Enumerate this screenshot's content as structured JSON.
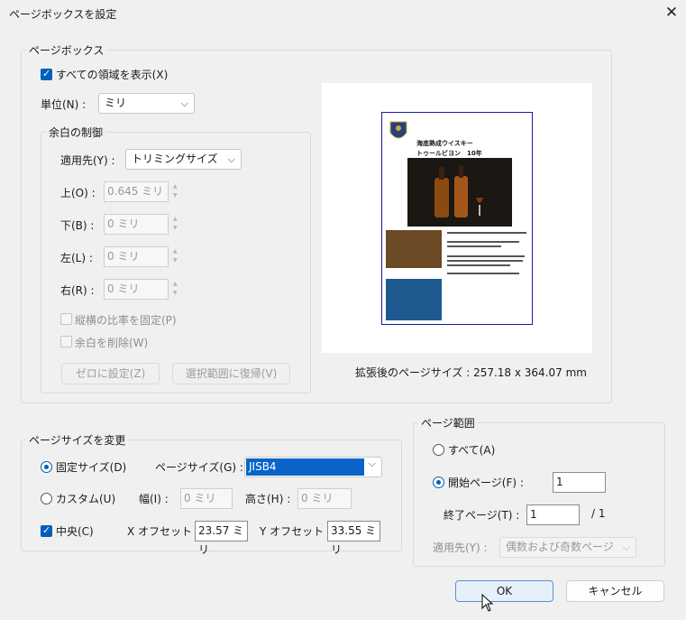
{
  "window": {
    "title": "ページボックスを設定",
    "close_glyph": "✕"
  },
  "page_box": {
    "legend": "ページボックス",
    "show_all": {
      "label": "すべての領域を表示(X)",
      "checked": true
    },
    "unit_label": "単位(N) :",
    "unit_value": "ミリ",
    "margin_group": {
      "legend": "余白の制御",
      "apply_label": "適用先(Y) :",
      "apply_value": "トリミングサイズ",
      "top_label": "上(O) :",
      "top_value": "0.645 ミリ",
      "bottom_label": "下(B) :",
      "bottom_value": "0 ミリ",
      "left_label": "左(L) :",
      "left_value": "0 ミリ",
      "right_label": "右(R) :",
      "right_value": "0 ミリ",
      "keep_ratio_label": "縦横の比率を固定(P)",
      "remove_margin_label": "余白を削除(W)",
      "set_zero_label": "ゼロに設定(Z)",
      "revert_label": "選択範囲に復帰(V)"
    },
    "preview": {
      "heading1": "海底熟成ウイスキー",
      "heading2": "トゥールビヨン　10年",
      "expanded_size_label": "拡張後のページサイズ : 257.18 x 364.07 mm"
    }
  },
  "page_size": {
    "legend": "ページサイズを変更",
    "fixed_label": "固定サイズ(D)",
    "fixed_selected": true,
    "size_label": "ページサイズ(G) :",
    "size_value": "JISB4",
    "custom_label": "カスタム(U)",
    "width_label": "幅(I) :",
    "width_value": "0 ミリ",
    "height_label": "高さ(H) :",
    "height_value": "0 ミリ",
    "center_label": "中央(C)",
    "center_checked": true,
    "x_offset_label": "X オフセット :",
    "x_offset_value": "23.57 ミリ",
    "y_offset_label": "Y オフセット :",
    "y_offset_value": "33.55 ミリ"
  },
  "page_range": {
    "legend": "ページ範囲",
    "all_label": "すべて(A)",
    "start_label": "開始ページ(F) :",
    "start_value": "1",
    "start_selected": true,
    "end_label": "終了ページ(T) :",
    "end_value": "1",
    "total_label": "/ 1",
    "apply_label": "適用先(Y) :",
    "apply_value": "偶数および奇数ページ"
  },
  "buttons": {
    "ok": "OK",
    "cancel": "キャンセル"
  },
  "colors": {
    "accent": "#005fb8",
    "highlight": "#0a64c8",
    "page_border": "#1a1aa0"
  }
}
